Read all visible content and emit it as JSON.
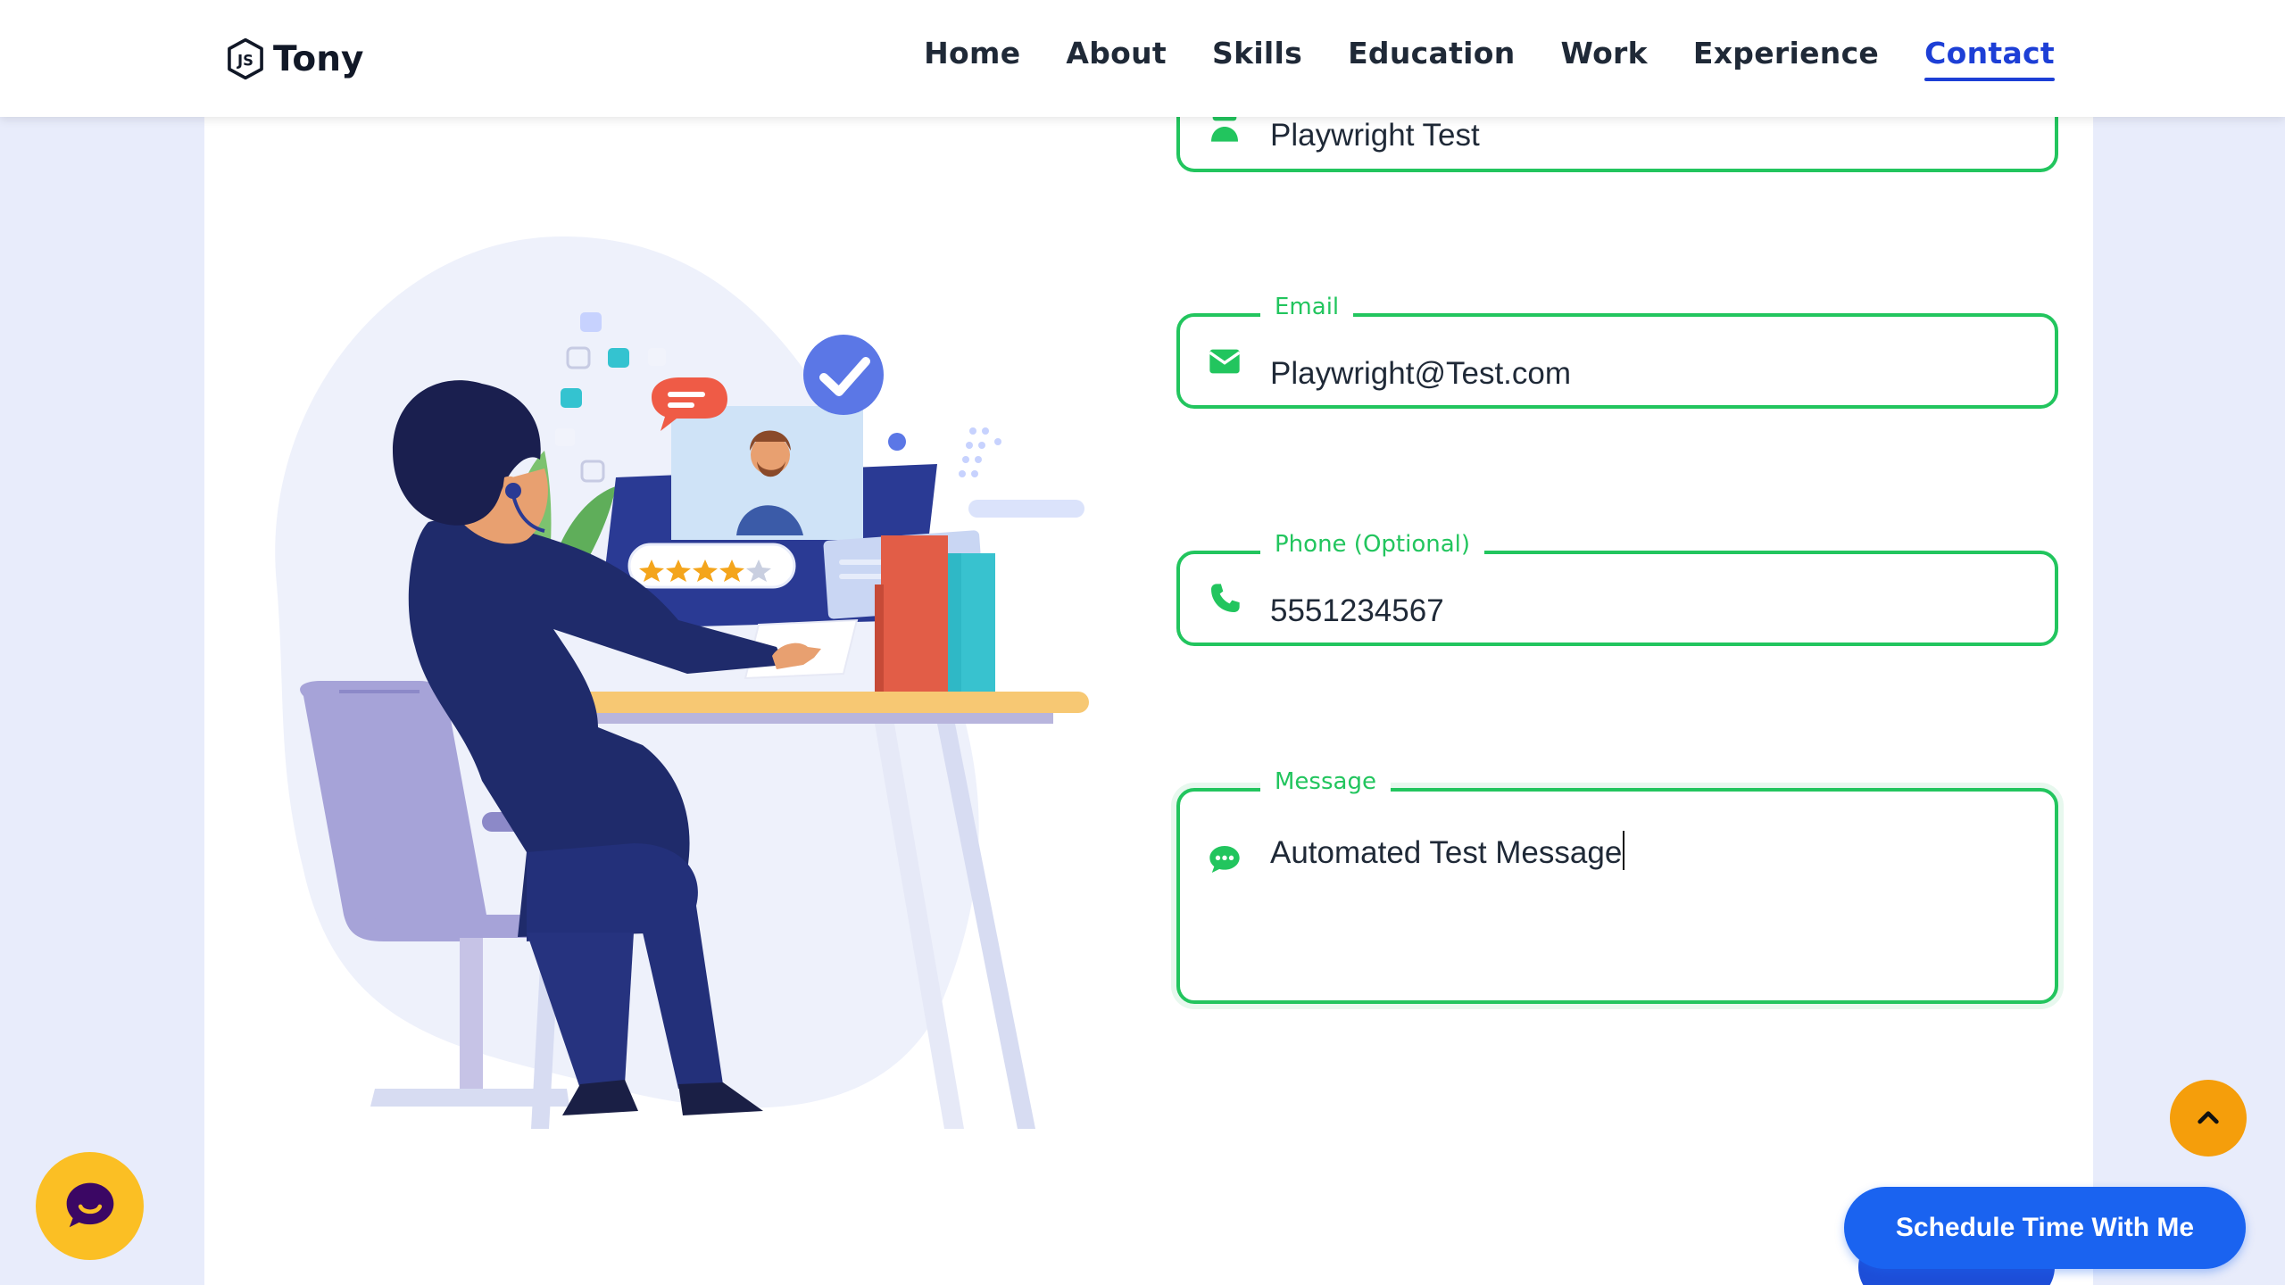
{
  "brand": {
    "name": "Tony",
    "icon": "js-hexagon-icon"
  },
  "nav": {
    "items": [
      {
        "label": "Home",
        "active": false
      },
      {
        "label": "About",
        "active": false
      },
      {
        "label": "Skills",
        "active": false
      },
      {
        "label": "Education",
        "active": false
      },
      {
        "label": "Work",
        "active": false
      },
      {
        "label": "Experience",
        "active": false
      },
      {
        "label": "Contact",
        "active": true
      }
    ],
    "active_color": "#1d3fd6"
  },
  "form": {
    "name": {
      "value": "Playwright Test",
      "icon": "user-icon"
    },
    "email": {
      "label": "Email",
      "value": "Playwright@Test.com",
      "icon": "envelope-icon"
    },
    "phone": {
      "label": "Phone (Optional)",
      "value": "5551234567",
      "icon": "phone-icon"
    },
    "message": {
      "label": "Message",
      "value": "Automated Test Message",
      "icon": "chat-dots-icon"
    },
    "accent_color": "#22c55e"
  },
  "buttons": {
    "schedule": "Schedule Time With Me"
  },
  "colors": {
    "page_bg": "#e8ecfb",
    "schedule_button": "#1a63f0",
    "chat_widget": "#fbbf24",
    "scroll_top": "#f59e0b"
  }
}
